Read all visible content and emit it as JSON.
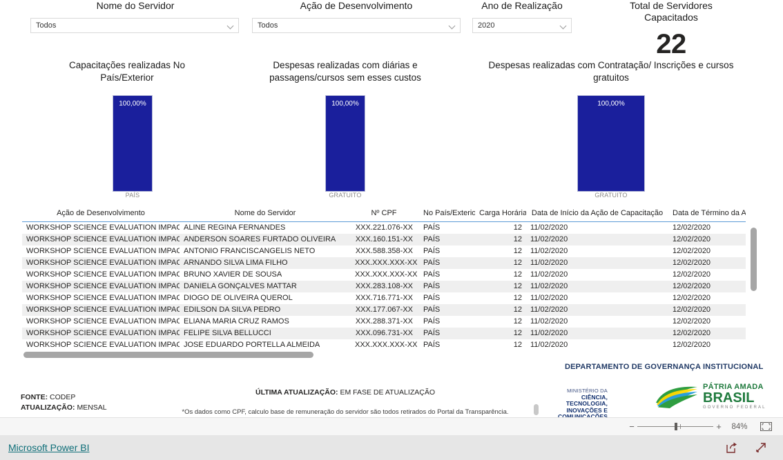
{
  "filters": [
    {
      "label": "Nome do Servidor",
      "value": "Todos",
      "name": "slicer-nome-servidor"
    },
    {
      "label": "Ação de Desenvolvimento",
      "value": "Todos",
      "name": "slicer-acao-desenvolvimento"
    },
    {
      "label": "Ano de Realização",
      "value": "2020",
      "name": "slicer-ano-realizacao"
    }
  ],
  "kpi": {
    "title": "Total de Servidores\nCapacitados",
    "title_line1": "Total de Servidores",
    "title_line2": "Capacitados",
    "value": "22"
  },
  "chart_data": [
    {
      "type": "bar",
      "title": "Capacitações realizadas No País/Exterior",
      "title_line1": "Capacitações realizadas No",
      "title_line2": "País/Exterior",
      "categories": [
        "PAÍS"
      ],
      "values": [
        100.0
      ],
      "data_labels": [
        "100,00%"
      ],
      "ylim": [
        0,
        100
      ],
      "xlabel": "",
      "ylabel": "",
      "grid": false,
      "legend": "none",
      "bar_color": "#1a1f9c"
    },
    {
      "type": "bar",
      "title": "Despesas realizadas com diárias e passagens/cursos sem esses custos",
      "title_line1": "Despesas realizadas com diárias e",
      "title_line2": "passagens/cursos sem esses custos",
      "categories": [
        "GRATUITO"
      ],
      "values": [
        100.0
      ],
      "data_labels": [
        "100,00%"
      ],
      "ylim": [
        0,
        100
      ],
      "xlabel": "",
      "ylabel": "",
      "grid": false,
      "legend": "none",
      "bar_color": "#1a1f9c"
    },
    {
      "type": "bar",
      "title": "Despesas realizadas com Contratação/ Inscrições e cursos gratuitos",
      "title_line1": "Despesas realizadas com Contratação/ Inscrições e cursos",
      "title_line2": "gratuitos",
      "categories": [
        "GRATUITO"
      ],
      "values": [
        100.0
      ],
      "data_labels": [
        "100,00%"
      ],
      "ylim": [
        0,
        100
      ],
      "xlabel": "",
      "ylabel": "",
      "grid": false,
      "legend": "none",
      "bar_color": "#1a1f9c"
    }
  ],
  "table": {
    "columns": [
      "Ação de Desenvolvimento",
      "Nome do Servidor",
      "Nº CPF",
      "No País/Exterior",
      "Carga Horária",
      "Data de Início da Ação de Capacitação",
      "Data de Término da Açã"
    ],
    "rows": [
      [
        "WORKSHOP SCIENCE EVALUATION IMPACT",
        "ALINE REGINA FERNANDES",
        "XXX.221.076-XX",
        "PAÍS",
        "12",
        "11/02/2020",
        "12/02/2020"
      ],
      [
        "WORKSHOP SCIENCE EVALUATION IMPACT",
        "ANDERSON SOARES FURTADO OLIVEIRA",
        "XXX.160.151-XX",
        "PAÍS",
        "12",
        "11/02/2020",
        "12/02/2020"
      ],
      [
        "WORKSHOP SCIENCE EVALUATION IMPACT",
        "ANTONIO FRANCISCANGELIS NETO",
        "XXX.588.358-XX",
        "PAÍS",
        "12",
        "11/02/2020",
        "12/02/2020"
      ],
      [
        "WORKSHOP SCIENCE EVALUATION IMPACT",
        "ARNANDO SILVA LIMA FILHO",
        "XXX.XXX.XXX-XX",
        "PAÍS",
        "12",
        "11/02/2020",
        "12/02/2020"
      ],
      [
        "WORKSHOP SCIENCE EVALUATION IMPACT",
        "BRUNO XAVIER DE SOUSA",
        "XXX.XXX.XXX-XX",
        "PAÍS",
        "12",
        "11/02/2020",
        "12/02/2020"
      ],
      [
        "WORKSHOP SCIENCE EVALUATION IMPACT",
        "DANIELA GONÇALVES MATTAR",
        "XXX.283.108-XX",
        "PAÍS",
        "12",
        "11/02/2020",
        "12/02/2020"
      ],
      [
        "WORKSHOP SCIENCE EVALUATION IMPACT",
        "DIOGO DE OLIVEIRA QUEROL",
        "XXX.716.771-XX",
        "PAÍS",
        "12",
        "11/02/2020",
        "12/02/2020"
      ],
      [
        "WORKSHOP SCIENCE EVALUATION IMPACT",
        "EDILSON DA SILVA PEDRO",
        "XXX.177.067-XX",
        "PAÍS",
        "12",
        "11/02/2020",
        "12/02/2020"
      ],
      [
        "WORKSHOP SCIENCE EVALUATION IMPACT",
        "ELIANA MARIA CRUZ RAMOS",
        "XXX.288.371-XX",
        "PAÍS",
        "12",
        "11/02/2020",
        "12/02/2020"
      ],
      [
        "WORKSHOP SCIENCE EVALUATION IMPACT",
        "FELIPE SILVA BELLUCCI",
        "XXX.096.731-XX",
        "PAÍS",
        "12",
        "11/02/2020",
        "12/02/2020"
      ],
      [
        "WORKSHOP SCIENCE EVALUATION IMPACT",
        "JOSE EDUARDO PORTELLA ALMEIDA",
        "XXX.XXX.XXX-XX",
        "PAÍS",
        "12",
        "11/02/2020",
        "12/02/2020"
      ]
    ]
  },
  "footer": {
    "fonte_label": "FONTE:",
    "fonte_value": "CODEP",
    "atualizacao_label": "ATUALIZAÇÃO:",
    "atualizacao_value": "MENSAL",
    "ultima_label": "ÚLTIMA ATUALIZAÇÃO:",
    "ultima_value": "EM FASE DE ATUALIZAÇÃO",
    "disclaimer": "*Os dados como CPF, calculo base de remuneração do servidor são todos retirados do Portal da Transparência.",
    "department": "DEPARTAMENTO DE GOVERNANÇA INSTITUCIONAL",
    "ministry_line1": "MINISTÉRIO DA",
    "ministry_line2": "CIÊNCIA, TECNOLOGIA,",
    "ministry_line3": "INOVAÇÕES E COMUNICAÇÕES",
    "brasil_line1": "PÁTRIA AMADA",
    "brasil_line2": "BRASIL",
    "brasil_line3": "GOVERNO FEDERAL"
  },
  "zoombar": {
    "minus": "−",
    "plus": "+",
    "percent": "84%",
    "fit_icon": "fit-to-page-icon"
  },
  "bottombar": {
    "brand": "Microsoft Power BI",
    "share_icon": "share-icon",
    "fullscreen_icon": "fullscreen-icon"
  },
  "colors": {
    "bar": "#1a1f9c",
    "link": "#0e6e78",
    "header_rule": "#5b9bd5",
    "dept": "#1f3864",
    "brasil_green": "#1f7a3d"
  }
}
